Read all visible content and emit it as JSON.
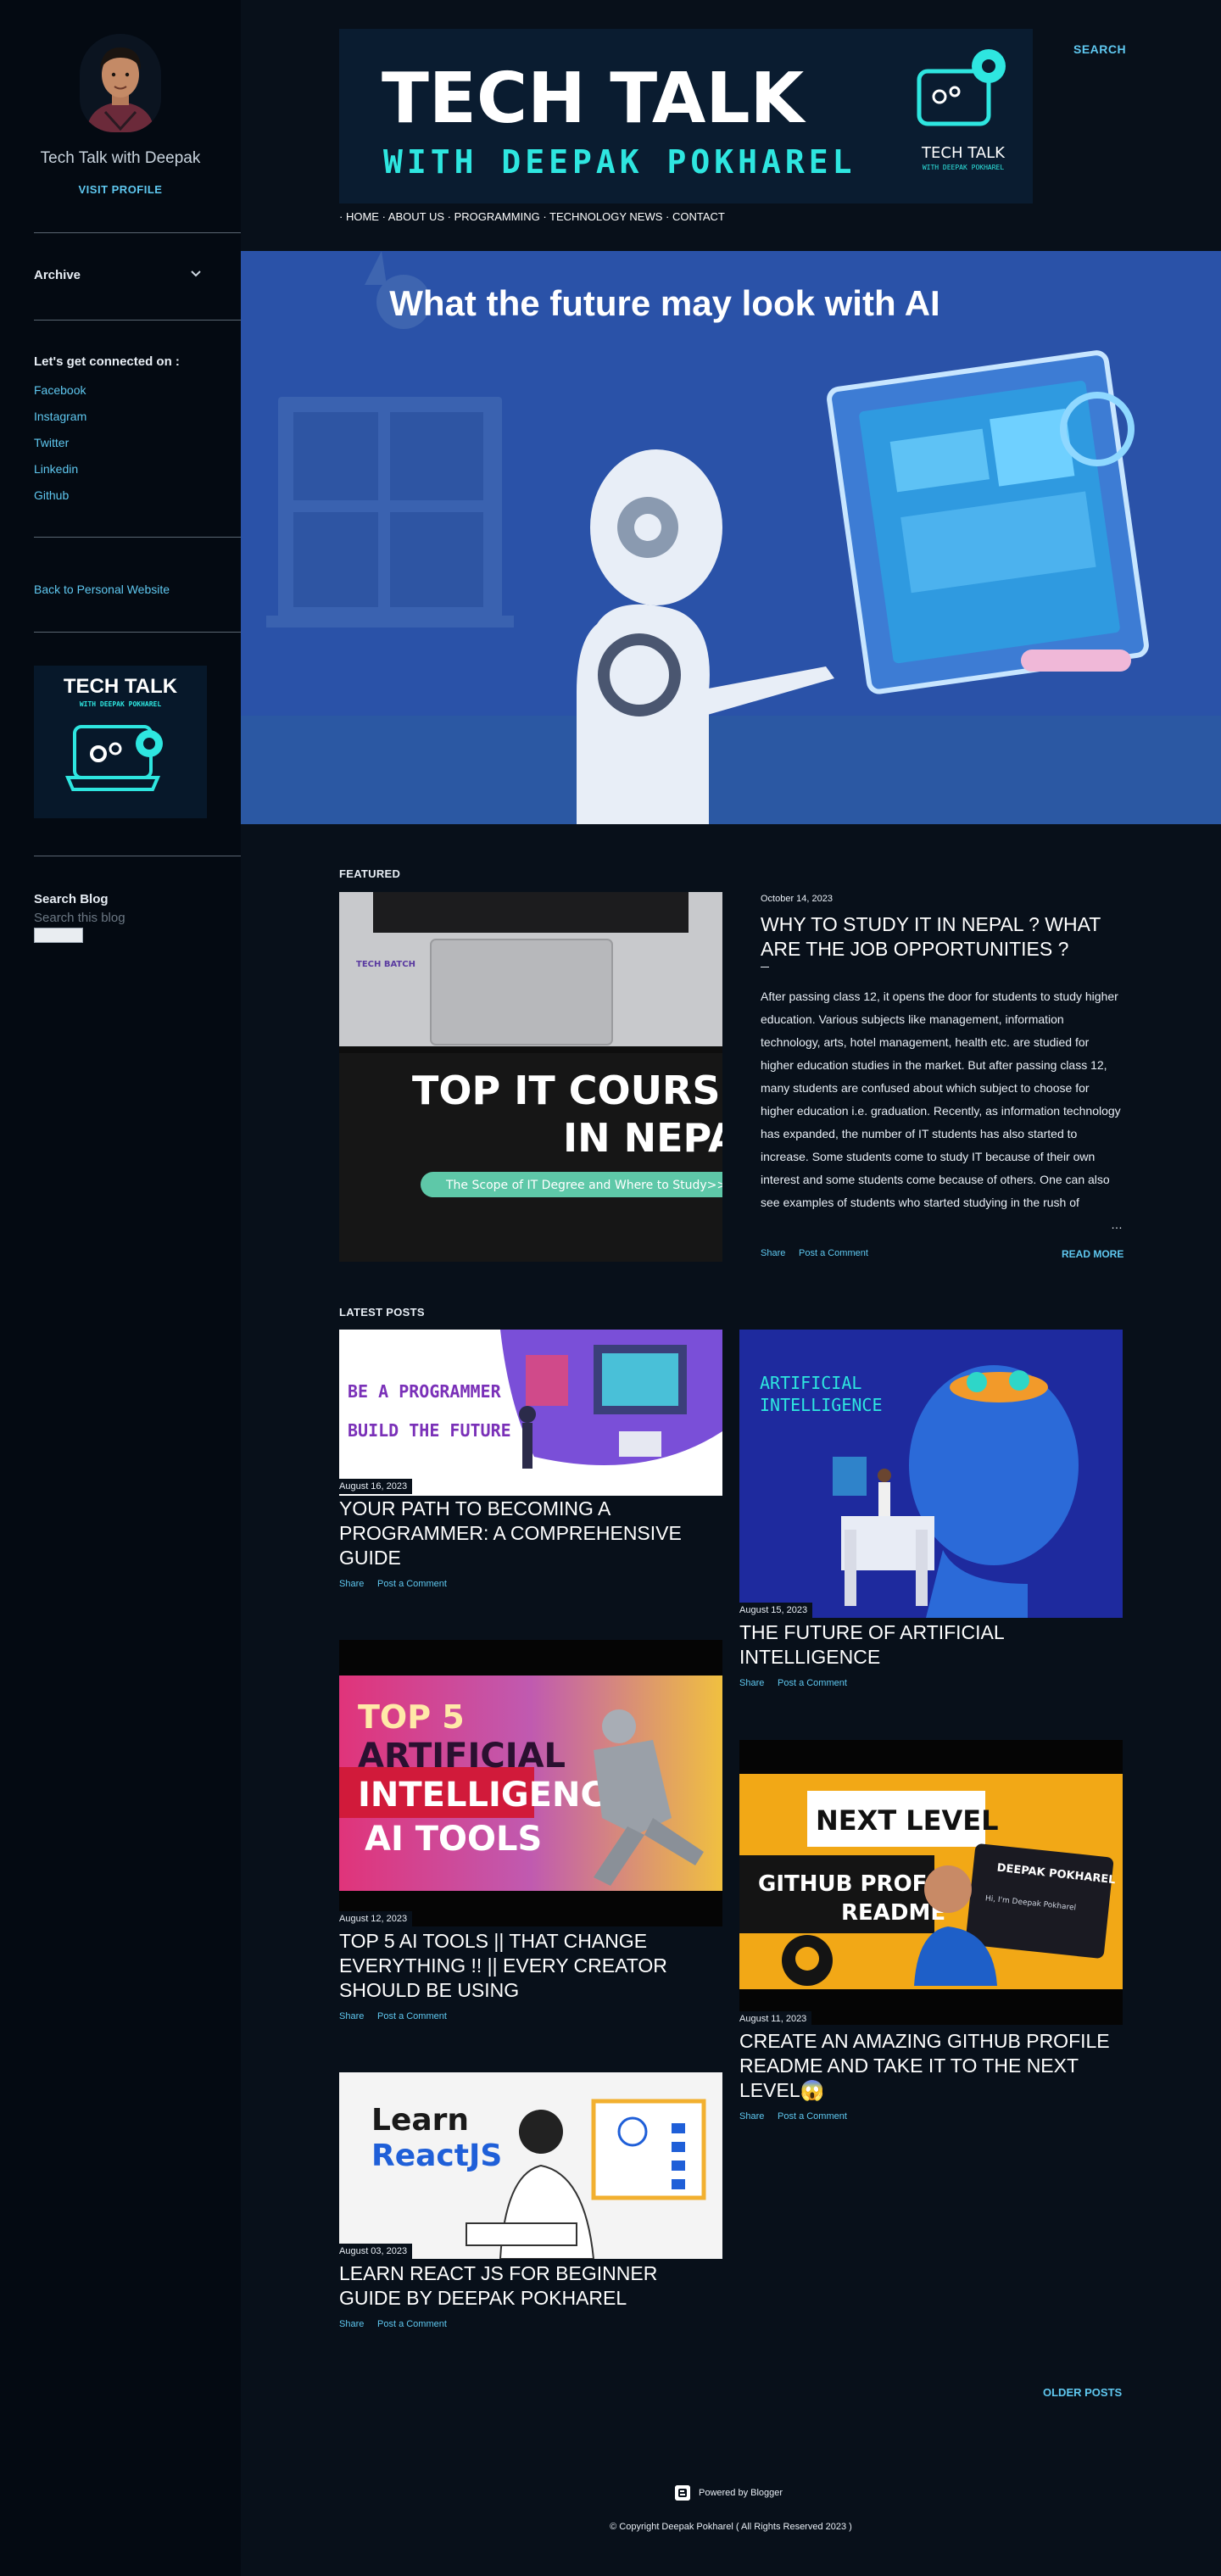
{
  "sidebar": {
    "profile_name": "Tech Talk with Deepak",
    "visit_profile": "VISIT PROFILE",
    "archive_label": "Archive",
    "connect_heading": "Let's get connected on :",
    "social_links": [
      "Facebook",
      "Instagram",
      "Twitter",
      "Linkedin",
      "Github"
    ],
    "back_link": "Back to Personal Website",
    "logo_title": "TECH TALK",
    "logo_subtitle": "WITH DEEPAK POKHAREL",
    "search_heading": "Search Blog",
    "search_placeholder": "Search this blog"
  },
  "header": {
    "banner_title": "TECH TALK",
    "banner_subtitle": "WITH DEEPAK POKHAREL",
    "banner_badge_title": "TECH TALK",
    "banner_badge_subtitle": "WITH DEEPAK POKHAREL",
    "search_label": "SEARCH",
    "nav": [
      "HOME",
      "ABOUT US",
      "PROGRAMMING",
      "TECHNOLOGY NEWS",
      "CONTACT"
    ]
  },
  "hero": {
    "heading": "What the future may look with AI"
  },
  "featured": {
    "section_label": "FEATURED",
    "image_line1": "TOP IT COURSE",
    "image_line2": "IN NEPA",
    "image_pill": "The Scope of IT Degree and Where to Study>>",
    "image_brand": "TECH BATCH",
    "date": "October 14, 2023",
    "title": "WHY TO STUDY IT IN NEPAL ? WHAT ARE THE JOB OPPORTUNITIES ?",
    "excerpt": " After passing class 12, it opens the door for students to study higher education. Various subjects like management, information technology, arts, hotel management, health etc. are studied for higher education studies in the market. But after passing class 12, many students are confused about which subject to choose for higher education i.e. graduation. Recently, as information technology has expanded, the number of IT students has also started to increase. Some students come to study IT because of their own interest and some students come because of others. One can also see examples of students who started studying in the rush of",
    "ellipsis": "…",
    "share": "Share",
    "comment": "Post a Comment",
    "read_more": "READ MORE"
  },
  "latest": {
    "section_label": "LATEST POSTS",
    "share": "Share",
    "comment": "Post a Comment",
    "posts": [
      {
        "date": "August 16, 2023",
        "title": "YOUR PATH TO BECOMING A PROGRAMMER: A COMPREHENSIVE GUIDE",
        "img_line1": "BE A PROGRAMMER",
        "img_line2": "BUILD THE FUTURE"
      },
      {
        "date": "August 15, 2023",
        "title": "THE FUTURE OF ARTIFICIAL INTELLIGENCE",
        "img_line1": "ARTIFICIAL",
        "img_line2": "INTELLIGENCE"
      },
      {
        "date": "August 12, 2023",
        "title": "TOP 5 AI TOOLS || THAT CHANGE EVERYTHING !! || EVERY CREATOR SHOULD BE USING",
        "img_line1": "TOP 5",
        "img_line2": "ARTIFICIAL",
        "img_line3": "INTELLIGENCE",
        "img_line4": "AI TOOLS"
      },
      {
        "date": "August 11, 2023",
        "title": "CREATE AN AMAZING GITHUB PROFILE README AND TAKE IT TO THE NEXT LEVEL😱",
        "img_line1": "NEXT LEVEL",
        "img_line2": "GITHUB PROFILE",
        "img_line3": "README",
        "img_screen": "DEEPAK POKHAREL",
        "img_screen_sub": "Hi, I'm Deepak Pokharel"
      },
      {
        "date": "August 03, 2023",
        "title": "LEARN REACT JS FOR BEGINNER GUIDE BY DEEPAK POKHAREL",
        "img_line1": "Learn",
        "img_line2": "ReactJS"
      }
    ]
  },
  "footer": {
    "older_posts": "OLDER POSTS",
    "powered": "Powered by Blogger",
    "copyright": "© Copyright Deepak Pokharel ( All Rights Reserved 2023 )"
  }
}
